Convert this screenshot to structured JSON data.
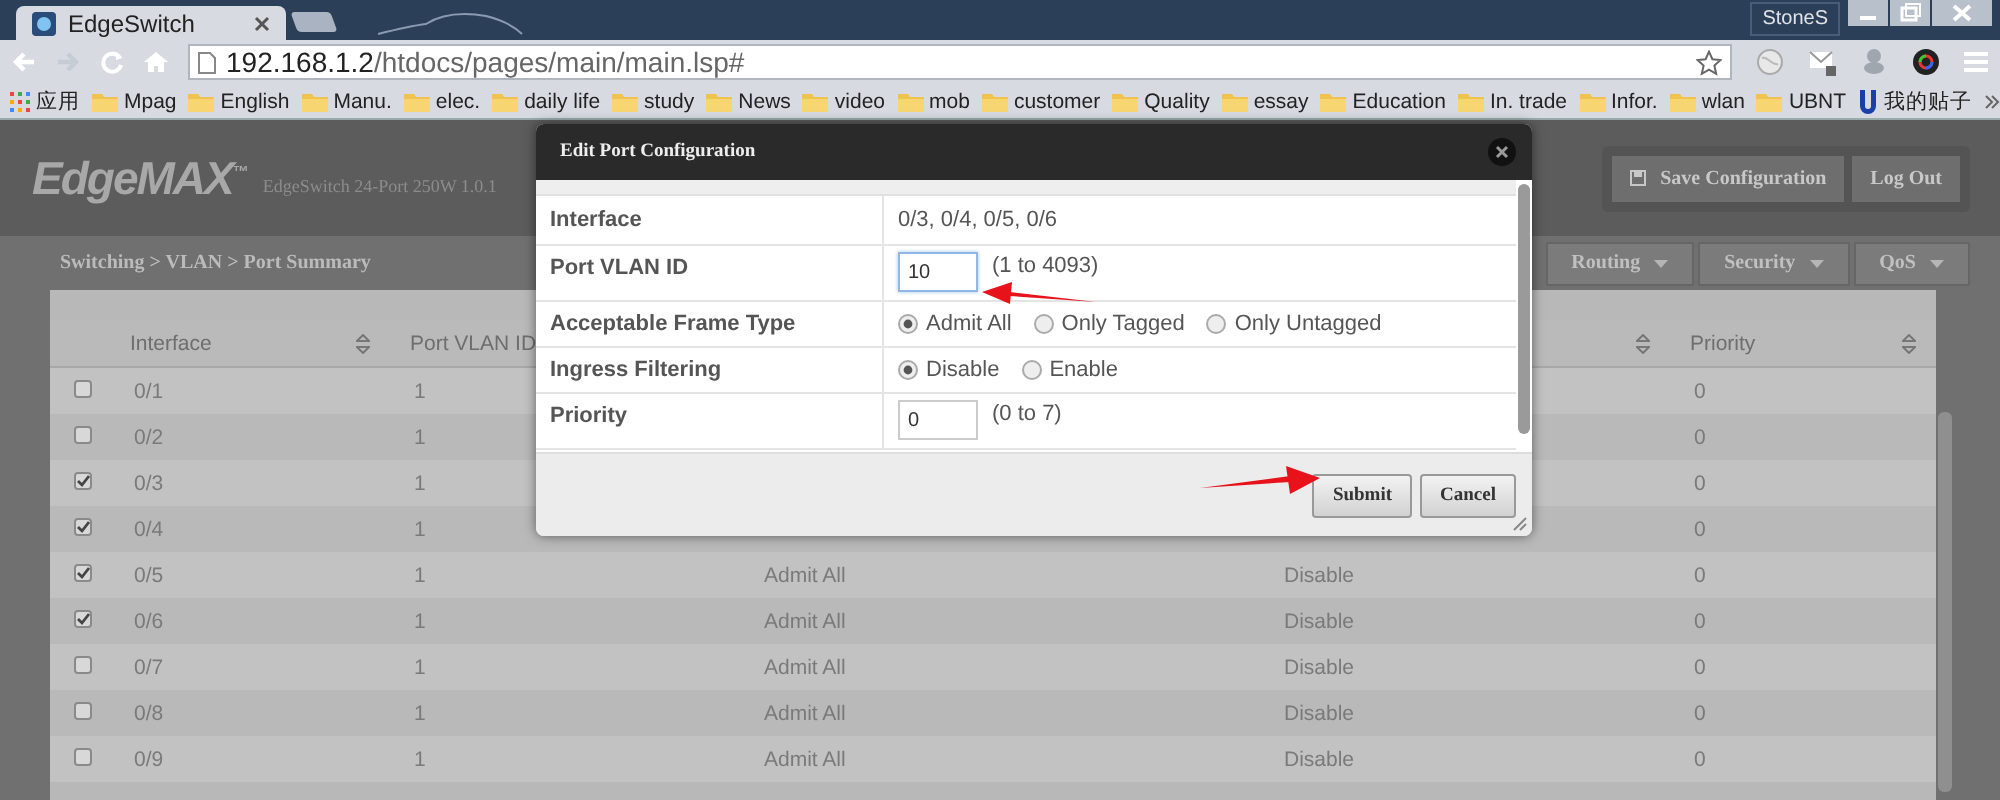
{
  "browser": {
    "tab": {
      "title": "EdgeSwitch"
    },
    "profile": "StoneS",
    "url": {
      "host": "192.168.1.2",
      "path": "/htdocs/pages/main/main.lsp#"
    },
    "bookmarks": [
      {
        "label": "应用",
        "kind": "apps"
      },
      {
        "label": "Mpag",
        "kind": "folder"
      },
      {
        "label": "English",
        "kind": "folder"
      },
      {
        "label": "Manu.",
        "kind": "folder"
      },
      {
        "label": "elec.",
        "kind": "folder"
      },
      {
        "label": "daily life",
        "kind": "folder"
      },
      {
        "label": "study",
        "kind": "folder"
      },
      {
        "label": "News",
        "kind": "folder"
      },
      {
        "label": "video",
        "kind": "folder"
      },
      {
        "label": "mob",
        "kind": "folder"
      },
      {
        "label": "customer",
        "kind": "folder"
      },
      {
        "label": "Quality",
        "kind": "folder"
      },
      {
        "label": "essay",
        "kind": "folder"
      },
      {
        "label": "Education",
        "kind": "folder"
      },
      {
        "label": "In. trade",
        "kind": "folder"
      },
      {
        "label": "Infor.",
        "kind": "folder"
      },
      {
        "label": "wlan",
        "kind": "folder"
      },
      {
        "label": "UBNT",
        "kind": "folder"
      },
      {
        "label": "我的贴子",
        "kind": "site"
      }
    ]
  },
  "header": {
    "logo": "EdgeMAX$^{™}$",
    "model": "EdgeSwitch 24-Port 250W 1.0.1",
    "buttons": [
      {
        "label": "Save Configuration",
        "kind": "icon"
      },
      {
        "label": "Log Out",
        "kind": "plain"
      }
    ]
  },
  "breadcrumb": "Switching > VLAN > Port Summary",
  "menu": [
    {
      "label": "Routing"
    },
    {
      "label": "Security"
    },
    {
      "label": "QoS"
    }
  ],
  "table": {
    "columns": [
      {
        "kind": "header",
        "label": "Interface",
        "sortable": true
      },
      {
        "kind": "header",
        "label": "Port VLAN ID"
      },
      {
        "kind": "hidden"
      },
      {
        "kind": "header",
        "sortable": true
      },
      {
        "kind": "header",
        "label": "Priority",
        "sortable": true
      }
    ],
    "rows": [
      {
        "checked": false,
        "interface": "0/1",
        "port_vlan_id": "1",
        "priority": "0"
      },
      {
        "checked": false,
        "interface": "0/2",
        "port_vlan_id": "1",
        "priority": "0"
      },
      {
        "checked": true,
        "interface": "0/3",
        "port_vlan_id": "1",
        "priority": "0"
      },
      {
        "checked": true,
        "interface": "0/4",
        "port_vlan_id": "1",
        "priority": "0"
      },
      {
        "checked": true,
        "interface": "0/5",
        "port_vlan_id": "1",
        "frame_type": "Admit All",
        "ingress_filtering": "Disable",
        "priority": "0"
      },
      {
        "checked": true,
        "interface": "0/6",
        "port_vlan_id": "1",
        "frame_type": "Admit All",
        "ingress_filtering": "Disable",
        "priority": "0"
      },
      {
        "checked": false,
        "interface": "0/7",
        "port_vlan_id": "1",
        "frame_type": "Admit All",
        "ingress_filtering": "Disable",
        "priority": "0"
      },
      {
        "checked": false,
        "interface": "0/8",
        "port_vlan_id": "1",
        "frame_type": "Admit All",
        "ingress_filtering": "Disable",
        "priority": "0"
      },
      {
        "checked": false,
        "interface": "0/9",
        "port_vlan_id": "1",
        "frame_type": "Admit All",
        "ingress_filtering": "Disable",
        "priority": "0"
      }
    ]
  },
  "dialog": {
    "title": "Edit Port Configuration",
    "fields": [
      {
        "kind": "text",
        "label": "Interface",
        "value": "0/3, 0/4, 0/5, 0/6"
      },
      {
        "kind": "input",
        "label": "Port VLAN ID",
        "value": "10",
        "hint": "(1 to 4093)",
        "focused": true
      },
      {
        "kind": "radio",
        "label": "Acceptable Frame Type",
        "options": [
          {
            "label": "Admit All",
            "selected": true
          },
          {
            "label": "Only Tagged",
            "selected": false
          },
          {
            "label": "Only Untagged",
            "selected": false
          }
        ]
      },
      {
        "kind": "radio",
        "label": "Ingress Filtering",
        "options": [
          {
            "label": "Disable",
            "selected": true
          },
          {
            "label": "Enable",
            "selected": false
          }
        ]
      },
      {
        "kind": "input",
        "label": "Priority",
        "value": "0",
        "hint": "(0 to 7)",
        "focused": false
      }
    ],
    "buttons": [
      {
        "label": "Submit"
      },
      {
        "label": "Cancel"
      }
    ]
  }
}
